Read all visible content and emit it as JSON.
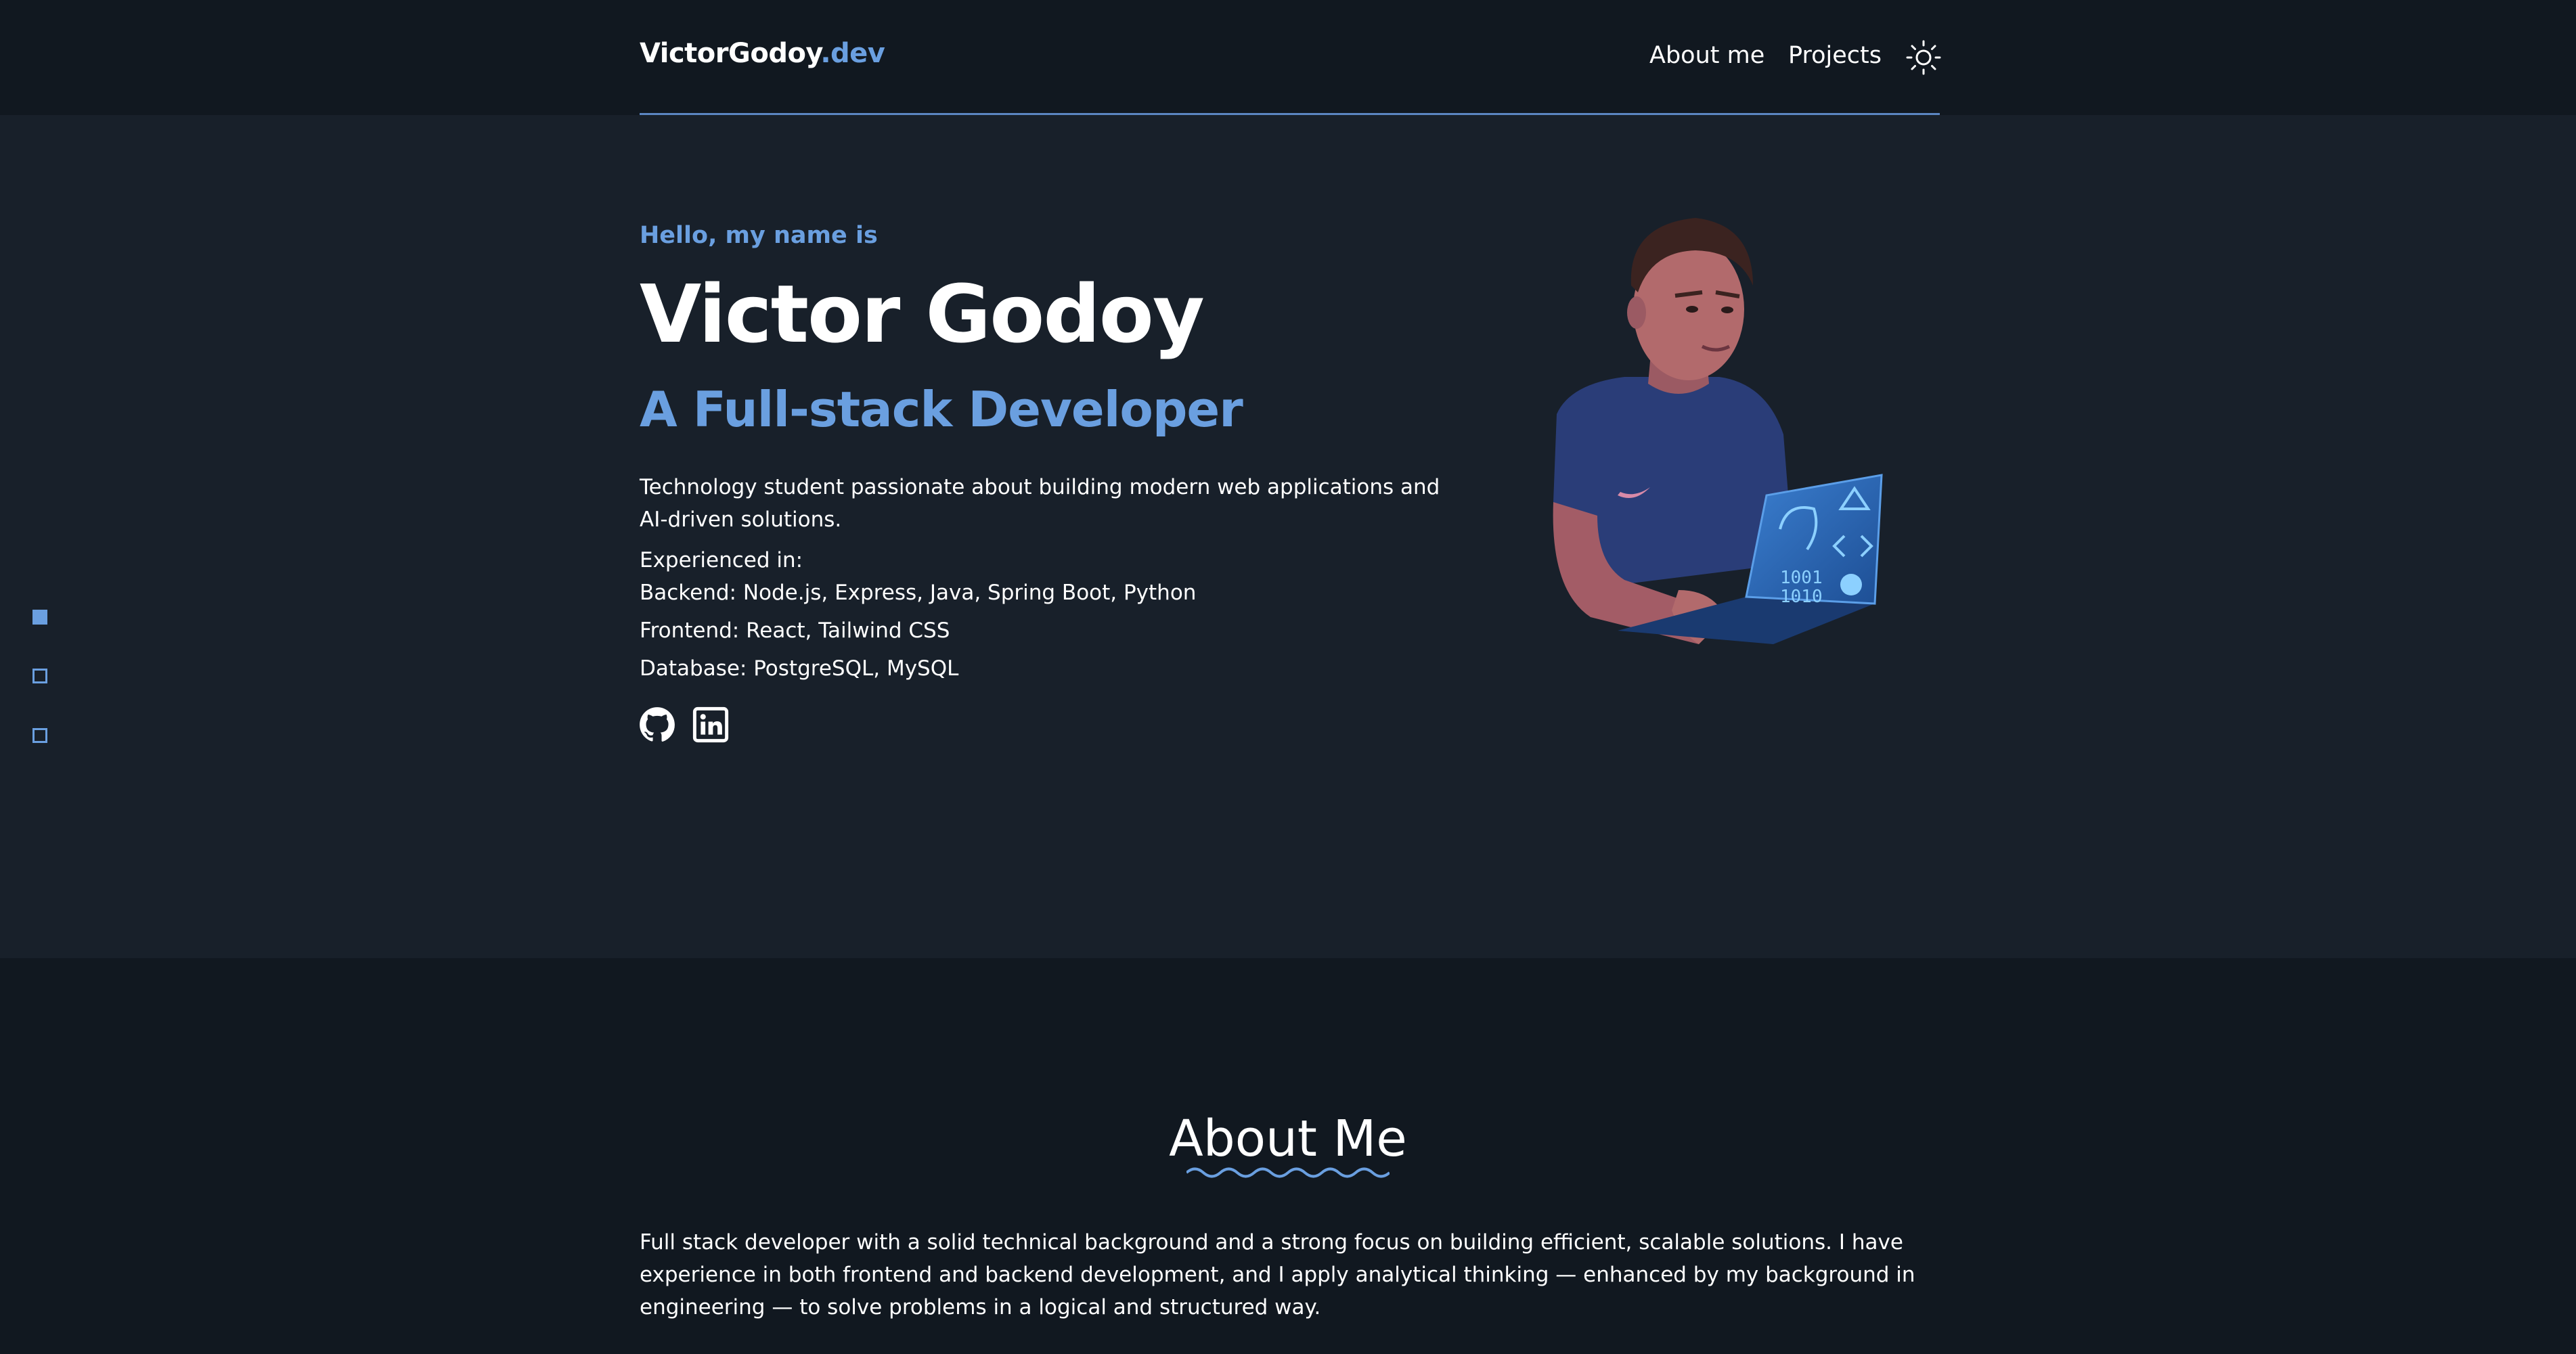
{
  "header": {
    "logo_main": "VictorGodoy",
    "logo_accent": ".dev",
    "nav": [
      {
        "label": "About me"
      },
      {
        "label": "Projects"
      }
    ],
    "theme_icon": "sun-icon"
  },
  "hero": {
    "greeting": "Hello, my name is",
    "name": "Victor Godoy",
    "role": "A Full-stack Developer",
    "description": "Technology student passionate about building modern web applications and AI-driven solutions.",
    "experience_heading": "Experienced in:",
    "experience": [
      "Backend: Node.js, Express, Java, Spring Boot, Python",
      "Frontend: React, Tailwind CSS",
      "Database: PostgreSQL, MySQL"
    ],
    "social": [
      {
        "icon": "github-icon"
      },
      {
        "icon": "linkedin-icon"
      }
    ],
    "avatar_laptop_text": [
      "1001",
      "1010"
    ]
  },
  "side_nav": {
    "dots": [
      {
        "active": true
      },
      {
        "active": false
      },
      {
        "active": false
      }
    ]
  },
  "about": {
    "title": "About Me",
    "text": "Full stack developer with a solid technical background and a strong focus on building efficient, scalable solutions. I have experience in both frontend and backend development, and I apply analytical thinking — enhanced by my background in engineering — to solve problems in a logical and structured way."
  },
  "colors": {
    "accent": "#6a9fe0",
    "header_bg": "#111820",
    "hero_bg": "#18202a",
    "page_bg": "#111820"
  }
}
